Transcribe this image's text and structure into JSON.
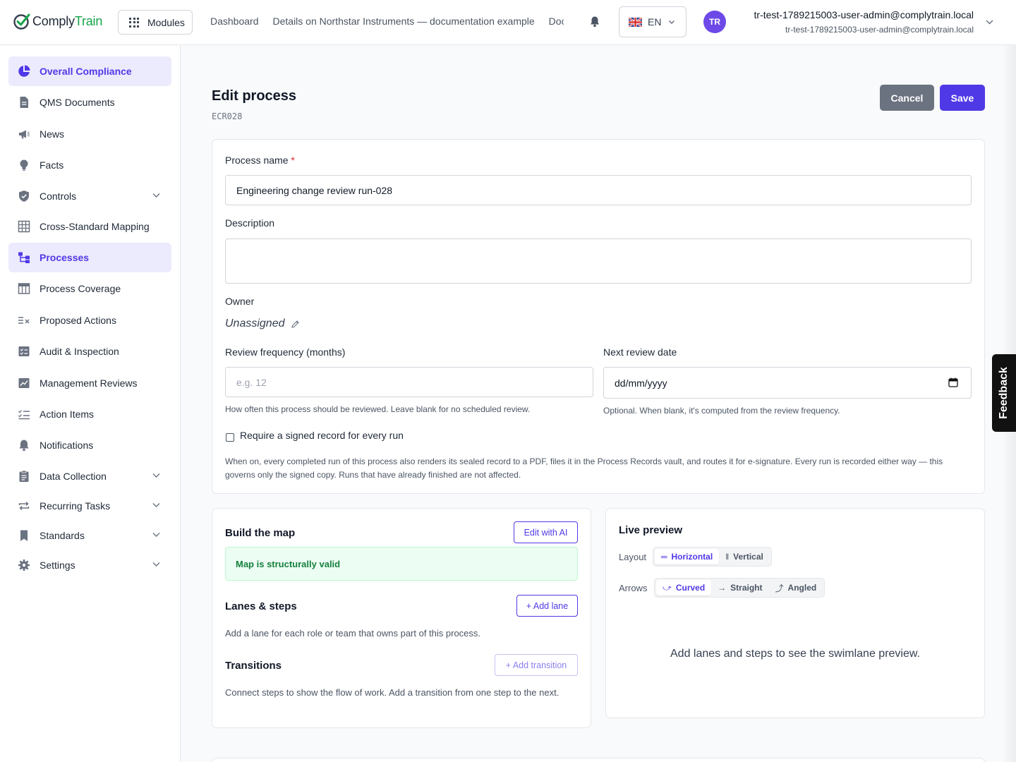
{
  "header": {
    "logo": {
      "part1": "Comply",
      "part2": "Train"
    },
    "modules_label": "Modules",
    "nav": [
      "Dashboard",
      "Details on Northstar Instruments — documentation example",
      "Documents"
    ],
    "language": "EN",
    "avatar_initials": "TR",
    "user_name": "tr-test-1789215003-user-admin@complytrain.local",
    "user_email": "tr-test-1789215003-user-admin@complytrain.local"
  },
  "sidebar": {
    "items": [
      {
        "label": "Overall Compliance",
        "icon": "pie-chart-icon",
        "active": true
      },
      {
        "label": "QMS Documents",
        "icon": "document-icon"
      },
      {
        "label": "News",
        "icon": "megaphone-icon"
      },
      {
        "label": "Facts",
        "icon": "lightbulb-icon"
      },
      {
        "label": "Controls",
        "icon": "shield-icon",
        "expandable": true
      },
      {
        "label": "Cross-Standard Mapping",
        "icon": "table-grid-icon"
      },
      {
        "label": "Processes",
        "icon": "flow-icon",
        "active": true
      },
      {
        "label": "Process Coverage",
        "icon": "table-icon"
      },
      {
        "label": "Proposed Actions",
        "icon": "list-x-icon"
      },
      {
        "label": "Audit & Inspection",
        "icon": "checklist-icon"
      },
      {
        "label": "Management Reviews",
        "icon": "chart-review-icon"
      },
      {
        "label": "Action Items",
        "icon": "list-check-icon"
      },
      {
        "label": "Notifications",
        "icon": "bell-icon"
      },
      {
        "label": "Data Collection",
        "icon": "clipboard-icon",
        "expandable": true
      },
      {
        "label": "Recurring Tasks",
        "icon": "repeat-icon",
        "expandable": true
      },
      {
        "label": "Standards",
        "icon": "bookmark-icon",
        "expandable": true
      },
      {
        "label": "Settings",
        "icon": "gear-icon",
        "expandable": true
      }
    ]
  },
  "page": {
    "title": "Edit process",
    "code": "ECR028",
    "cancel_label": "Cancel",
    "save_label": "Save"
  },
  "form": {
    "process_name_label": "Process name",
    "required_mark": "*",
    "process_name_value": "Engineering change review run-028",
    "description_label": "Description",
    "description_value": "",
    "owner_label": "Owner",
    "owner_value": "Unassigned",
    "review_freq_label": "Review frequency (months)",
    "review_freq_placeholder": "e.g. 12",
    "review_freq_help": "How often this process should be reviewed. Leave blank for no scheduled review.",
    "next_review_label": "Next review date",
    "next_review_value": "dd/mm/yyyy",
    "next_review_help": "Optional. When blank, it's computed from the review frequency.",
    "signed_record_label": "Require a signed record for every run",
    "signed_record_checked": false,
    "signed_record_help": "When on, every completed run of this process also renders its sealed record to a PDF, files it in the Process Records vault, and routes it for e-signature. Every run is recorded either way — this governs only the signed copy. Runs that have already finished are not affected."
  },
  "builder": {
    "title": "Build the map",
    "edit_ai_label": "Edit with AI",
    "valid_message": "Map is structurally valid",
    "lanes_title": "Lanes & steps",
    "add_lane_label": "+ Add lane",
    "lanes_help": "Add a lane for each role or team that owns part of this process.",
    "transitions_title": "Transitions",
    "add_transition_label": "+ Add transition",
    "transitions_help": "Connect steps to show the flow of work. Add a transition from one step to the next."
  },
  "preview": {
    "title": "Live preview",
    "layout_label": "Layout",
    "layout_options": [
      "Horizontal",
      "Vertical"
    ],
    "layout_selected": "Horizontal",
    "arrows_label": "Arrows",
    "arrows_options": [
      "Curved",
      "Straight",
      "Angled"
    ],
    "arrows_selected": "Curved",
    "empty_message": "Add lanes and steps to see the swimlane preview."
  },
  "feedback_label": "Feedback",
  "colors": {
    "accent": "#4f39e6",
    "brand_green": "#16a34a",
    "cancel": "#6b7280",
    "valid_bg": "#ecfdf3"
  }
}
